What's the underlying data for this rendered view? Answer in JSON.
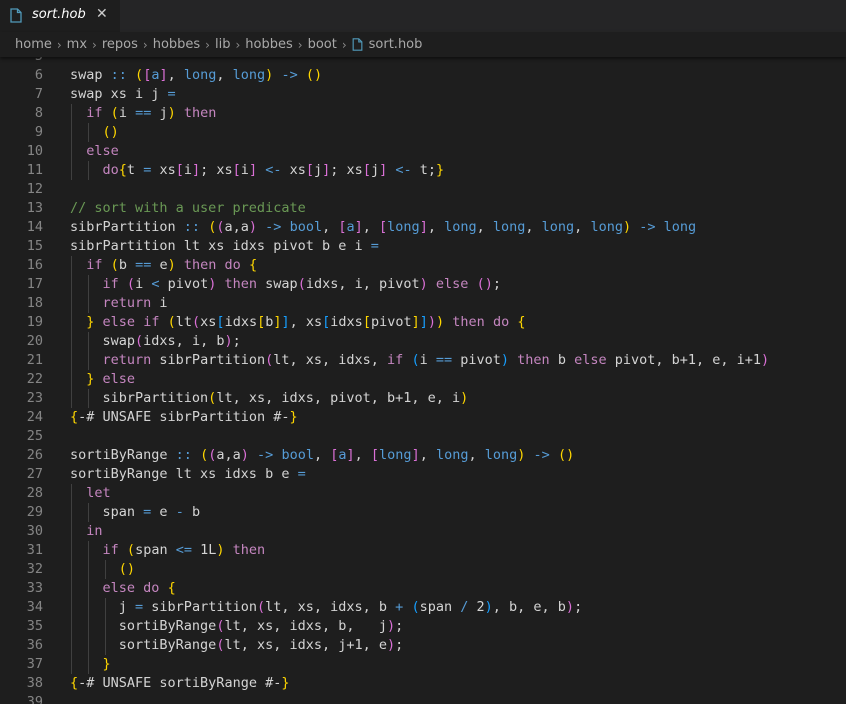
{
  "tab": {
    "filename": "sort.hob",
    "close_glyph": "✕",
    "icon": "file-icon"
  },
  "breadcrumb": {
    "segments": [
      "home",
      "mx",
      "repos",
      "hobbes",
      "lib",
      "hobbes",
      "boot"
    ],
    "file": "sort.hob",
    "separator": "›"
  },
  "colors": {
    "keyword": "#c586c0",
    "type": "#569cd6",
    "comment": "#6a9955",
    "bracket1": "#ffd700",
    "bracket2": "#da70d6",
    "bracket3": "#179fff",
    "text": "#d4d4d4",
    "line_number": "#858585"
  },
  "lines": [
    {
      "n": "5",
      "segs": []
    },
    {
      "n": "6",
      "segs": [
        [
          "tx",
          "swap "
        ],
        [
          "op",
          "::"
        ],
        [
          "tx",
          " "
        ],
        [
          "b1",
          "("
        ],
        [
          "b2",
          "["
        ],
        [
          "ty",
          "a"
        ],
        [
          "b2",
          "]"
        ],
        [
          "tx",
          ", "
        ],
        [
          "ty",
          "long"
        ],
        [
          "tx",
          ", "
        ],
        [
          "ty",
          "long"
        ],
        [
          "b1",
          ")"
        ],
        [
          "tx",
          " "
        ],
        [
          "op",
          "->"
        ],
        [
          "tx",
          " "
        ],
        [
          "b1",
          "()"
        ]
      ]
    },
    {
      "n": "7",
      "segs": [
        [
          "tx",
          "swap xs i j "
        ],
        [
          "op",
          "="
        ]
      ]
    },
    {
      "n": "8",
      "segs": [
        [
          "tx",
          "  "
        ],
        [
          "kw",
          "if"
        ],
        [
          "tx",
          " "
        ],
        [
          "b1",
          "("
        ],
        [
          "tx",
          "i "
        ],
        [
          "op",
          "=="
        ],
        [
          "tx",
          " j"
        ],
        [
          "b1",
          ")"
        ],
        [
          "tx",
          " "
        ],
        [
          "kw",
          "then"
        ]
      ]
    },
    {
      "n": "9",
      "segs": [
        [
          "tx",
          "    "
        ],
        [
          "b1",
          "()"
        ]
      ]
    },
    {
      "n": "10",
      "segs": [
        [
          "tx",
          "  "
        ],
        [
          "kw",
          "else"
        ]
      ]
    },
    {
      "n": "11",
      "segs": [
        [
          "tx",
          "    "
        ],
        [
          "kw",
          "do"
        ],
        [
          "b1",
          "{"
        ],
        [
          "tx",
          "t "
        ],
        [
          "op",
          "="
        ],
        [
          "tx",
          " xs"
        ],
        [
          "b2",
          "["
        ],
        [
          "tx",
          "i"
        ],
        [
          "b2",
          "]"
        ],
        [
          "tx",
          "; xs"
        ],
        [
          "b2",
          "["
        ],
        [
          "tx",
          "i"
        ],
        [
          "b2",
          "]"
        ],
        [
          "tx",
          " "
        ],
        [
          "op",
          "<-"
        ],
        [
          "tx",
          " xs"
        ],
        [
          "b2",
          "["
        ],
        [
          "tx",
          "j"
        ],
        [
          "b2",
          "]"
        ],
        [
          "tx",
          "; xs"
        ],
        [
          "b2",
          "["
        ],
        [
          "tx",
          "j"
        ],
        [
          "b2",
          "]"
        ],
        [
          "tx",
          " "
        ],
        [
          "op",
          "<-"
        ],
        [
          "tx",
          " t;"
        ],
        [
          "b1",
          "}"
        ]
      ]
    },
    {
      "n": "12",
      "segs": []
    },
    {
      "n": "13",
      "segs": [
        [
          "cm",
          "// sort with a user predicate"
        ]
      ]
    },
    {
      "n": "14",
      "segs": [
        [
          "tx",
          "sibrPartition "
        ],
        [
          "op",
          "::"
        ],
        [
          "tx",
          " "
        ],
        [
          "b1",
          "("
        ],
        [
          "b2",
          "("
        ],
        [
          "tx",
          "a,a"
        ],
        [
          "b2",
          ")"
        ],
        [
          "tx",
          " "
        ],
        [
          "op",
          "->"
        ],
        [
          "tx",
          " "
        ],
        [
          "ty",
          "bool"
        ],
        [
          "tx",
          ", "
        ],
        [
          "b2",
          "["
        ],
        [
          "ty",
          "a"
        ],
        [
          "b2",
          "]"
        ],
        [
          "tx",
          ", "
        ],
        [
          "b2",
          "["
        ],
        [
          "ty",
          "long"
        ],
        [
          "b2",
          "]"
        ],
        [
          "tx",
          ", "
        ],
        [
          "ty",
          "long"
        ],
        [
          "tx",
          ", "
        ],
        [
          "ty",
          "long"
        ],
        [
          "tx",
          ", "
        ],
        [
          "ty",
          "long"
        ],
        [
          "tx",
          ", "
        ],
        [
          "ty",
          "long"
        ],
        [
          "b1",
          ")"
        ],
        [
          "tx",
          " "
        ],
        [
          "op",
          "->"
        ],
        [
          "tx",
          " "
        ],
        [
          "ty",
          "long"
        ]
      ]
    },
    {
      "n": "15",
      "segs": [
        [
          "tx",
          "sibrPartition lt xs idxs pivot b e i "
        ],
        [
          "op",
          "="
        ]
      ]
    },
    {
      "n": "16",
      "segs": [
        [
          "tx",
          "  "
        ],
        [
          "kw",
          "if"
        ],
        [
          "tx",
          " "
        ],
        [
          "b1",
          "("
        ],
        [
          "tx",
          "b "
        ],
        [
          "op",
          "=="
        ],
        [
          "tx",
          " e"
        ],
        [
          "b1",
          ")"
        ],
        [
          "tx",
          " "
        ],
        [
          "kw",
          "then"
        ],
        [
          "tx",
          " "
        ],
        [
          "kw",
          "do"
        ],
        [
          "tx",
          " "
        ],
        [
          "b1",
          "{"
        ]
      ]
    },
    {
      "n": "17",
      "segs": [
        [
          "tx",
          "    "
        ],
        [
          "kw",
          "if"
        ],
        [
          "tx",
          " "
        ],
        [
          "b2",
          "("
        ],
        [
          "tx",
          "i "
        ],
        [
          "op",
          "<"
        ],
        [
          "tx",
          " pivot"
        ],
        [
          "b2",
          ")"
        ],
        [
          "tx",
          " "
        ],
        [
          "kw",
          "then"
        ],
        [
          "tx",
          " swap"
        ],
        [
          "b2",
          "("
        ],
        [
          "tx",
          "idxs, i, pivot"
        ],
        [
          "b2",
          ")"
        ],
        [
          "tx",
          " "
        ],
        [
          "kw",
          "else"
        ],
        [
          "tx",
          " "
        ],
        [
          "b2",
          "()"
        ],
        [
          "tx",
          ";"
        ]
      ]
    },
    {
      "n": "18",
      "segs": [
        [
          "tx",
          "    "
        ],
        [
          "kw",
          "return"
        ],
        [
          "tx",
          " i"
        ]
      ]
    },
    {
      "n": "19",
      "segs": [
        [
          "tx",
          "  "
        ],
        [
          "b1",
          "}"
        ],
        [
          "tx",
          " "
        ],
        [
          "kw",
          "else"
        ],
        [
          "tx",
          " "
        ],
        [
          "kw",
          "if"
        ],
        [
          "tx",
          " "
        ],
        [
          "b1",
          "("
        ],
        [
          "tx",
          "lt"
        ],
        [
          "b2",
          "("
        ],
        [
          "tx",
          "xs"
        ],
        [
          "b3",
          "["
        ],
        [
          "tx",
          "idxs"
        ],
        [
          "b1",
          "["
        ],
        [
          "tx",
          "b"
        ],
        [
          "b1",
          "]"
        ],
        [
          "b3",
          "]"
        ],
        [
          "tx",
          ", xs"
        ],
        [
          "b3",
          "["
        ],
        [
          "tx",
          "idxs"
        ],
        [
          "b1",
          "["
        ],
        [
          "tx",
          "pivot"
        ],
        [
          "b1",
          "]"
        ],
        [
          "b3",
          "]"
        ],
        [
          "b2",
          ")"
        ],
        [
          "b1",
          ")"
        ],
        [
          "tx",
          " "
        ],
        [
          "kw",
          "then"
        ],
        [
          "tx",
          " "
        ],
        [
          "kw",
          "do"
        ],
        [
          "tx",
          " "
        ],
        [
          "b1",
          "{"
        ]
      ]
    },
    {
      "n": "20",
      "segs": [
        [
          "tx",
          "    swap"
        ],
        [
          "b2",
          "("
        ],
        [
          "tx",
          "idxs, i, b"
        ],
        [
          "b2",
          ")"
        ],
        [
          "tx",
          ";"
        ]
      ]
    },
    {
      "n": "21",
      "segs": [
        [
          "tx",
          "    "
        ],
        [
          "kw",
          "return"
        ],
        [
          "tx",
          " sibrPartition"
        ],
        [
          "b2",
          "("
        ],
        [
          "tx",
          "lt, xs, idxs, "
        ],
        [
          "kw",
          "if"
        ],
        [
          "tx",
          " "
        ],
        [
          "b3",
          "("
        ],
        [
          "tx",
          "i "
        ],
        [
          "op",
          "=="
        ],
        [
          "tx",
          " pivot"
        ],
        [
          "b3",
          ")"
        ],
        [
          "tx",
          " "
        ],
        [
          "kw",
          "then"
        ],
        [
          "tx",
          " b "
        ],
        [
          "kw",
          "else"
        ],
        [
          "tx",
          " pivot, b+1, e, i+1"
        ],
        [
          "b2",
          ")"
        ]
      ]
    },
    {
      "n": "22",
      "segs": [
        [
          "tx",
          "  "
        ],
        [
          "b1",
          "}"
        ],
        [
          "tx",
          " "
        ],
        [
          "kw",
          "else"
        ]
      ]
    },
    {
      "n": "23",
      "segs": [
        [
          "tx",
          "    sibrPartition"
        ],
        [
          "b1",
          "("
        ],
        [
          "tx",
          "lt, xs, idxs, pivot, b+1, e, i"
        ],
        [
          "b1",
          ")"
        ]
      ]
    },
    {
      "n": "24",
      "segs": [
        [
          "b1",
          "{"
        ],
        [
          "tx",
          "-# UNSAFE sibrPartition #-"
        ],
        [
          "b1",
          "}"
        ]
      ]
    },
    {
      "n": "25",
      "segs": []
    },
    {
      "n": "26",
      "segs": [
        [
          "tx",
          "sortiByRange "
        ],
        [
          "op",
          "::"
        ],
        [
          "tx",
          " "
        ],
        [
          "b1",
          "("
        ],
        [
          "b2",
          "("
        ],
        [
          "tx",
          "a,a"
        ],
        [
          "b2",
          ")"
        ],
        [
          "tx",
          " "
        ],
        [
          "op",
          "->"
        ],
        [
          "tx",
          " "
        ],
        [
          "ty",
          "bool"
        ],
        [
          "tx",
          ", "
        ],
        [
          "b2",
          "["
        ],
        [
          "ty",
          "a"
        ],
        [
          "b2",
          "]"
        ],
        [
          "tx",
          ", "
        ],
        [
          "b2",
          "["
        ],
        [
          "ty",
          "long"
        ],
        [
          "b2",
          "]"
        ],
        [
          "tx",
          ", "
        ],
        [
          "ty",
          "long"
        ],
        [
          "tx",
          ", "
        ],
        [
          "ty",
          "long"
        ],
        [
          "b1",
          ")"
        ],
        [
          "tx",
          " "
        ],
        [
          "op",
          "->"
        ],
        [
          "tx",
          " "
        ],
        [
          "b1",
          "()"
        ]
      ]
    },
    {
      "n": "27",
      "segs": [
        [
          "tx",
          "sortiByRange lt xs idxs b e "
        ],
        [
          "op",
          "="
        ]
      ]
    },
    {
      "n": "28",
      "segs": [
        [
          "tx",
          "  "
        ],
        [
          "kw",
          "let"
        ]
      ]
    },
    {
      "n": "29",
      "segs": [
        [
          "tx",
          "    span "
        ],
        [
          "op",
          "="
        ],
        [
          "tx",
          " e "
        ],
        [
          "op",
          "-"
        ],
        [
          "tx",
          " b"
        ]
      ]
    },
    {
      "n": "30",
      "segs": [
        [
          "tx",
          "  "
        ],
        [
          "kw",
          "in"
        ]
      ]
    },
    {
      "n": "31",
      "segs": [
        [
          "tx",
          "    "
        ],
        [
          "kw",
          "if"
        ],
        [
          "tx",
          " "
        ],
        [
          "b1",
          "("
        ],
        [
          "tx",
          "span "
        ],
        [
          "op",
          "<="
        ],
        [
          "tx",
          " 1L"
        ],
        [
          "b1",
          ")"
        ],
        [
          "tx",
          " "
        ],
        [
          "kw",
          "then"
        ]
      ]
    },
    {
      "n": "32",
      "segs": [
        [
          "tx",
          "      "
        ],
        [
          "b1",
          "()"
        ]
      ]
    },
    {
      "n": "33",
      "segs": [
        [
          "tx",
          "    "
        ],
        [
          "kw",
          "else"
        ],
        [
          "tx",
          " "
        ],
        [
          "kw",
          "do"
        ],
        [
          "tx",
          " "
        ],
        [
          "b1",
          "{"
        ]
      ]
    },
    {
      "n": "34",
      "segs": [
        [
          "tx",
          "      j "
        ],
        [
          "op",
          "="
        ],
        [
          "tx",
          " sibrPartition"
        ],
        [
          "b2",
          "("
        ],
        [
          "tx",
          "lt, xs, idxs, b "
        ],
        [
          "op",
          "+"
        ],
        [
          "tx",
          " "
        ],
        [
          "b3",
          "("
        ],
        [
          "tx",
          "span "
        ],
        [
          "op",
          "/"
        ],
        [
          "tx",
          " 2"
        ],
        [
          "b3",
          ")"
        ],
        [
          "tx",
          ", b, e, b"
        ],
        [
          "b2",
          ")"
        ],
        [
          "tx",
          ";"
        ]
      ]
    },
    {
      "n": "35",
      "segs": [
        [
          "tx",
          "      sortiByRange"
        ],
        [
          "b2",
          "("
        ],
        [
          "tx",
          "lt, xs, idxs, b,   j"
        ],
        [
          "b2",
          ")"
        ],
        [
          "tx",
          ";"
        ]
      ]
    },
    {
      "n": "36",
      "segs": [
        [
          "tx",
          "      sortiByRange"
        ],
        [
          "b2",
          "("
        ],
        [
          "tx",
          "lt, xs, idxs, j+1, e"
        ],
        [
          "b2",
          ")"
        ],
        [
          "tx",
          ";"
        ]
      ]
    },
    {
      "n": "37",
      "segs": [
        [
          "tx",
          "    "
        ],
        [
          "b1",
          "}"
        ]
      ]
    },
    {
      "n": "38",
      "segs": [
        [
          "b1",
          "{"
        ],
        [
          "tx",
          "-# UNSAFE sortiByRange #-"
        ],
        [
          "b1",
          "}"
        ]
      ]
    },
    {
      "n": "39",
      "segs": []
    }
  ]
}
